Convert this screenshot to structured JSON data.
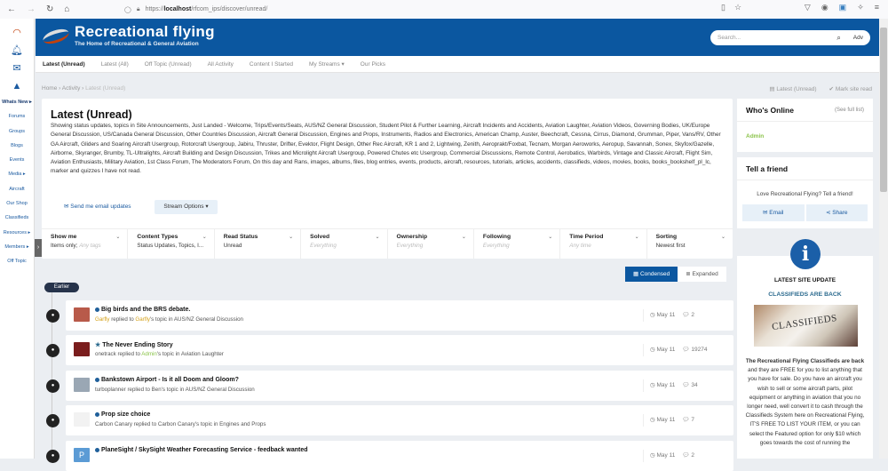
{
  "browser": {
    "url_prefix": "https://",
    "url_host": "localhost",
    "url_path": "/rfcom_ips/discover/unread/"
  },
  "rail": {
    "items": [
      {
        "label": "Whats New ▸",
        "bold": true
      },
      {
        "label": "Forums"
      },
      {
        "label": "Groups"
      },
      {
        "label": "Blogs"
      },
      {
        "label": "Events"
      },
      {
        "label": "Media ▸"
      },
      {
        "label": "Aircraft"
      },
      {
        "label": "Our Shop"
      },
      {
        "label": "Classifieds"
      },
      {
        "label": "Resources ▸"
      },
      {
        "label": "Members ▸"
      },
      {
        "label": "Off Topic"
      }
    ]
  },
  "header": {
    "title": "Recreational flying",
    "subtitle": "The Home of Recreational & General Aviation",
    "search_placeholder": "Search...",
    "adv_label": "Adv"
  },
  "tabs": [
    "Latest (Unread)",
    "Latest (All)",
    "Off Topic (Unread)",
    "All Activity",
    "Content I Started",
    "My Streams ▾",
    "Our Picks"
  ],
  "breadcrumb": {
    "home": "Home",
    "sep": " › ",
    "activity": "Activity",
    "current": "Latest (Unread)"
  },
  "top_actions": {
    "latest": "Latest (Unread)",
    "mark_read": "Mark site read"
  },
  "main": {
    "title": "Latest (Unread)",
    "description": "Showing status updates, topics in Site Announcements, Just Landed - Welcome, Trips/Events/Seats, AUS/NZ General Discussion, Student Pilot & Further Learning, Aircraft Incidents and Accidents, Aviation Laughter, Aviation Videos, Governing Bodies, UK/Europe General Discussion, US/Canada General Discussion, Other Countries Discussion, Aircraft General Discussion, Engines and Props, Instruments, Radios and Electronics, American Champ, Auster, Beechcraft, Cessna, Cirrus, Diamond, Grumman, Piper, Vans/RV, Other GA Aircraft, Gliders and Soaring Aircraft Usergroup, Rotorcraft Usergroup, Jabiru, Thruster, Drifter, Evektor, Flight Design, Other Rec Aircraft, KR 1 and 2, Lightwing, Zenith, Aeroprakt/Foxbat, Tecnam, Morgan Aeroworks, Aeropup, Savannah, Sonex, Skyfox/Gazelle, Airborne, Skyranger, Brumby, TL-Ultralights, Aircraft Building and Design Discussion, Trikes and Microlight Aircraft Usergroup, Powered Chutes etc Usergroup, Commercial Discussions, Remote Control, Aerobatics, Warbirds, Vintage and Classic Aircraft, Flight Sim, Aviation Enthusiasts, Military Aviation, 1st Class Forum, The Moderators Forum, On this day and Rans, images, albums, files, blog entries, events, products, aircraft, resources, tutorials, articles, accidents, classifieds, videos, movies, books, books_bookshelf_pl_lc, marker and quizzes I have not read.",
    "email_updates": "Send me email updates",
    "stream_options": "Stream Options ▾"
  },
  "filters": [
    {
      "label": "Show me",
      "value": "Items only; ",
      "muted_value": "Any tags"
    },
    {
      "label": "Content Types",
      "value": "Status Updates, Topics, I...",
      "muted_value": ""
    },
    {
      "label": "Read Status",
      "value": "Unread",
      "muted_value": ""
    },
    {
      "label": "Solved",
      "value": "",
      "muted_value": "Everything"
    },
    {
      "label": "Ownership",
      "value": "",
      "muted_value": "Everything"
    },
    {
      "label": "Following",
      "value": "",
      "muted_value": "Everything"
    },
    {
      "label": "Time Period",
      "value": "",
      "muted_value": "Any time"
    },
    {
      "label": "Sorting",
      "value": "Newest first",
      "muted_value": ""
    }
  ],
  "view": {
    "condensed": "Condensed",
    "expanded": "Expanded",
    "selected": "Condensed"
  },
  "earlier_label": "Earlier",
  "stream": [
    {
      "marker": "dot",
      "title": "Big birds and the BRS debate.",
      "user": "Garfly",
      "action": " replied to ",
      "owner": "Garfly",
      "owner_suffix": "'s topic in AUS/NZ General Discussion",
      "user_color": "gold",
      "owner_color": "gold",
      "date": "May 11",
      "replies": "2",
      "thumb_color": "#b85a4a"
    },
    {
      "marker": "star",
      "title": "The Never Ending Story",
      "user": "onetrack",
      "action": " replied to ",
      "owner": "Admin",
      "owner_suffix": "'s topic in Aviation Laughter",
      "user_color": "",
      "owner_color": "green",
      "date": "May 11",
      "replies": "19274",
      "thumb_color": "#7a1d1d"
    },
    {
      "marker": "dot",
      "title": "Bankstown Airport - Is it all Doom and Gloom?",
      "user": "turboplanner",
      "action": " replied to ",
      "owner": "Ben",
      "owner_suffix": "'s topic in AUS/NZ General Discussion",
      "user_color": "",
      "owner_color": "",
      "date": "May 11",
      "replies": "34",
      "thumb_color": "#9aa7b4"
    },
    {
      "marker": "dot",
      "title": "Prop size choice",
      "user": "Carbon Canary",
      "action": " replied to ",
      "owner": "Carbon Canary",
      "owner_suffix": "'s topic in Engines and Props",
      "user_color": "",
      "owner_color": "",
      "date": "May 11",
      "replies": "7",
      "thumb_color": "#f2f2f2"
    },
    {
      "marker": "dot",
      "title": "PlaneSight / SkySight Weather Forecasting Service - feedback wanted",
      "user": "",
      "action": "",
      "owner": "",
      "owner_suffix": "",
      "user_color": "",
      "owner_color": "",
      "date": "May 11",
      "replies": "2",
      "thumb_color": "#5b9bd5",
      "thumb_letter": "P"
    }
  ],
  "sidebar": {
    "whos_online": {
      "title": "Who's Online",
      "see_all": "(See full list)",
      "users": [
        "Admin"
      ]
    },
    "tell_friend": {
      "title": "Tell a friend",
      "text": "Love Recreational Flying? Tell a friend!",
      "email": "Email",
      "share": "Share"
    },
    "update": {
      "heading": "LATEST SITE UPDATE",
      "subheading": "CLASSIFIEDS ARE BACK",
      "image_text": "CLASSIFIEDS",
      "body_bold": "The Recreational Flying Classifieds are back",
      "body": " and they are FREE for you to list anything that you have for sale. Do you have an aircraft you wish to sell or some aircraft parts, pilot equipment or anything in aviation that you no longer need, well convert it to cash through the Classifieds System here on Recreational Flying, IT'S FREE TO LIST YOUR ITEM, or you can select the Featured option for only $10 which goes towards the cost of running the"
    }
  }
}
